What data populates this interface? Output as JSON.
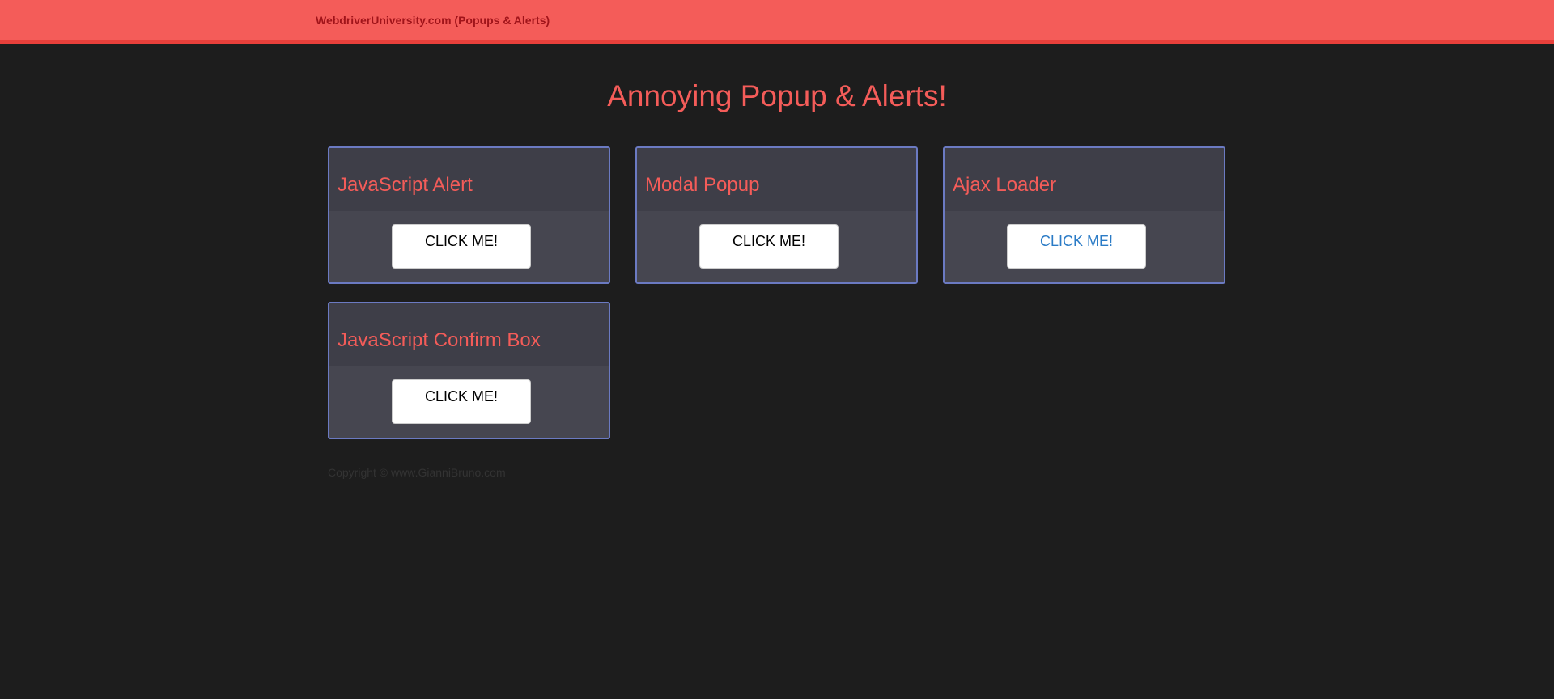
{
  "nav": {
    "brand": "WebdriverUniversity.com (Popups & Alerts)"
  },
  "page_title": "Annoying Popup & Alerts!",
  "cards": [
    {
      "title": "JavaScript Alert",
      "button": "CLICK ME!"
    },
    {
      "title": "Modal Popup",
      "button": "CLICK ME!"
    },
    {
      "title": "Ajax Loader",
      "button": "CLICK ME!"
    },
    {
      "title": "JavaScript Confirm Box",
      "button": "CLICK ME!"
    }
  ],
  "footer": {
    "copyright": "Copyright © www.GianniBruno.com"
  },
  "colors": {
    "accent": "#f45c59",
    "card_border": "#6b7ac2",
    "background": "#1d1d1d",
    "link": "#2a7bc6"
  }
}
